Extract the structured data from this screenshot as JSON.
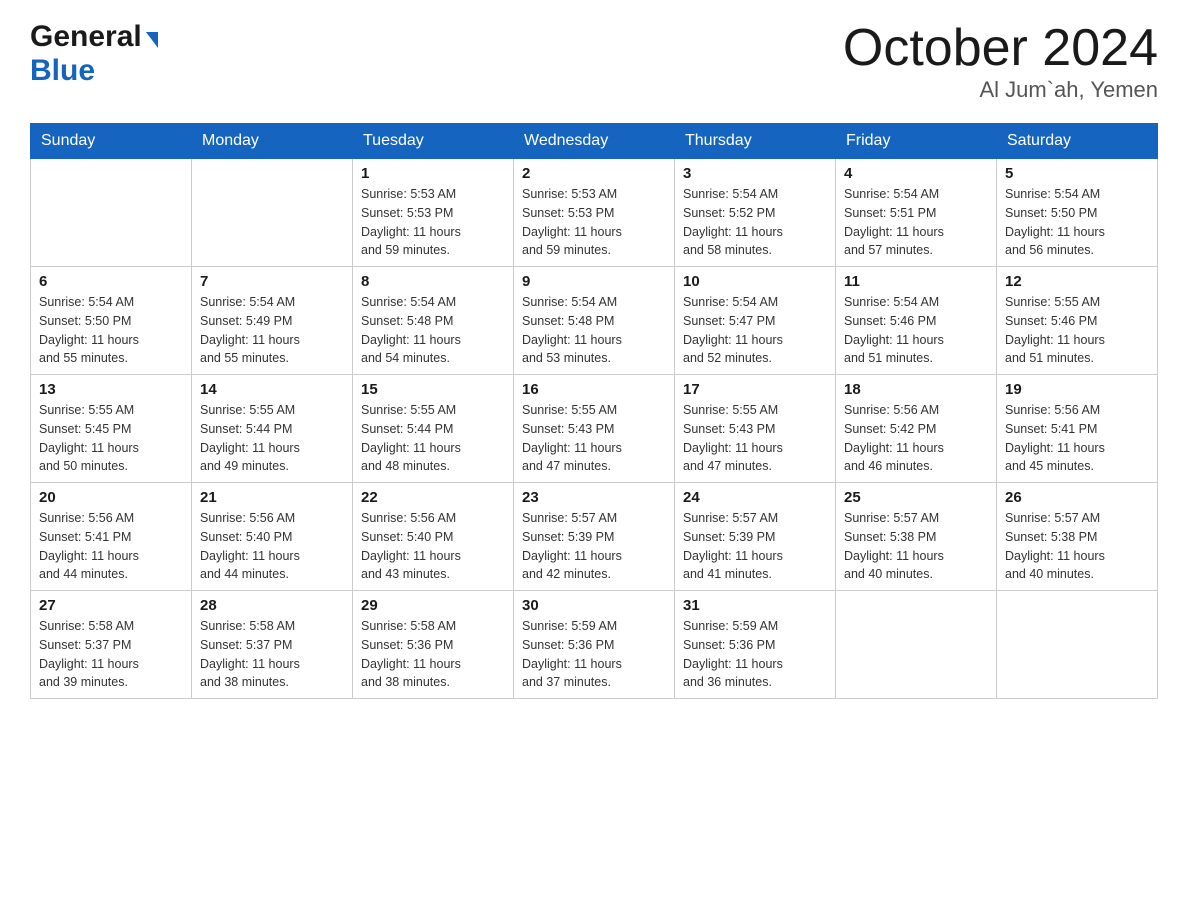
{
  "logo": {
    "general": "General",
    "blue": "Blue"
  },
  "title": "October 2024",
  "subtitle": "Al Jum`ah, Yemen",
  "days_of_week": [
    "Sunday",
    "Monday",
    "Tuesday",
    "Wednesday",
    "Thursday",
    "Friday",
    "Saturday"
  ],
  "weeks": [
    [
      {
        "day": "",
        "info": ""
      },
      {
        "day": "",
        "info": ""
      },
      {
        "day": "1",
        "info": "Sunrise: 5:53 AM\nSunset: 5:53 PM\nDaylight: 11 hours\nand 59 minutes."
      },
      {
        "day": "2",
        "info": "Sunrise: 5:53 AM\nSunset: 5:53 PM\nDaylight: 11 hours\nand 59 minutes."
      },
      {
        "day": "3",
        "info": "Sunrise: 5:54 AM\nSunset: 5:52 PM\nDaylight: 11 hours\nand 58 minutes."
      },
      {
        "day": "4",
        "info": "Sunrise: 5:54 AM\nSunset: 5:51 PM\nDaylight: 11 hours\nand 57 minutes."
      },
      {
        "day": "5",
        "info": "Sunrise: 5:54 AM\nSunset: 5:50 PM\nDaylight: 11 hours\nand 56 minutes."
      }
    ],
    [
      {
        "day": "6",
        "info": "Sunrise: 5:54 AM\nSunset: 5:50 PM\nDaylight: 11 hours\nand 55 minutes."
      },
      {
        "day": "7",
        "info": "Sunrise: 5:54 AM\nSunset: 5:49 PM\nDaylight: 11 hours\nand 55 minutes."
      },
      {
        "day": "8",
        "info": "Sunrise: 5:54 AM\nSunset: 5:48 PM\nDaylight: 11 hours\nand 54 minutes."
      },
      {
        "day": "9",
        "info": "Sunrise: 5:54 AM\nSunset: 5:48 PM\nDaylight: 11 hours\nand 53 minutes."
      },
      {
        "day": "10",
        "info": "Sunrise: 5:54 AM\nSunset: 5:47 PM\nDaylight: 11 hours\nand 52 minutes."
      },
      {
        "day": "11",
        "info": "Sunrise: 5:54 AM\nSunset: 5:46 PM\nDaylight: 11 hours\nand 51 minutes."
      },
      {
        "day": "12",
        "info": "Sunrise: 5:55 AM\nSunset: 5:46 PM\nDaylight: 11 hours\nand 51 minutes."
      }
    ],
    [
      {
        "day": "13",
        "info": "Sunrise: 5:55 AM\nSunset: 5:45 PM\nDaylight: 11 hours\nand 50 minutes."
      },
      {
        "day": "14",
        "info": "Sunrise: 5:55 AM\nSunset: 5:44 PM\nDaylight: 11 hours\nand 49 minutes."
      },
      {
        "day": "15",
        "info": "Sunrise: 5:55 AM\nSunset: 5:44 PM\nDaylight: 11 hours\nand 48 minutes."
      },
      {
        "day": "16",
        "info": "Sunrise: 5:55 AM\nSunset: 5:43 PM\nDaylight: 11 hours\nand 47 minutes."
      },
      {
        "day": "17",
        "info": "Sunrise: 5:55 AM\nSunset: 5:43 PM\nDaylight: 11 hours\nand 47 minutes."
      },
      {
        "day": "18",
        "info": "Sunrise: 5:56 AM\nSunset: 5:42 PM\nDaylight: 11 hours\nand 46 minutes."
      },
      {
        "day": "19",
        "info": "Sunrise: 5:56 AM\nSunset: 5:41 PM\nDaylight: 11 hours\nand 45 minutes."
      }
    ],
    [
      {
        "day": "20",
        "info": "Sunrise: 5:56 AM\nSunset: 5:41 PM\nDaylight: 11 hours\nand 44 minutes."
      },
      {
        "day": "21",
        "info": "Sunrise: 5:56 AM\nSunset: 5:40 PM\nDaylight: 11 hours\nand 44 minutes."
      },
      {
        "day": "22",
        "info": "Sunrise: 5:56 AM\nSunset: 5:40 PM\nDaylight: 11 hours\nand 43 minutes."
      },
      {
        "day": "23",
        "info": "Sunrise: 5:57 AM\nSunset: 5:39 PM\nDaylight: 11 hours\nand 42 minutes."
      },
      {
        "day": "24",
        "info": "Sunrise: 5:57 AM\nSunset: 5:39 PM\nDaylight: 11 hours\nand 41 minutes."
      },
      {
        "day": "25",
        "info": "Sunrise: 5:57 AM\nSunset: 5:38 PM\nDaylight: 11 hours\nand 40 minutes."
      },
      {
        "day": "26",
        "info": "Sunrise: 5:57 AM\nSunset: 5:38 PM\nDaylight: 11 hours\nand 40 minutes."
      }
    ],
    [
      {
        "day": "27",
        "info": "Sunrise: 5:58 AM\nSunset: 5:37 PM\nDaylight: 11 hours\nand 39 minutes."
      },
      {
        "day": "28",
        "info": "Sunrise: 5:58 AM\nSunset: 5:37 PM\nDaylight: 11 hours\nand 38 minutes."
      },
      {
        "day": "29",
        "info": "Sunrise: 5:58 AM\nSunset: 5:36 PM\nDaylight: 11 hours\nand 38 minutes."
      },
      {
        "day": "30",
        "info": "Sunrise: 5:59 AM\nSunset: 5:36 PM\nDaylight: 11 hours\nand 37 minutes."
      },
      {
        "day": "31",
        "info": "Sunrise: 5:59 AM\nSunset: 5:36 PM\nDaylight: 11 hours\nand 36 minutes."
      },
      {
        "day": "",
        "info": ""
      },
      {
        "day": "",
        "info": ""
      }
    ]
  ]
}
